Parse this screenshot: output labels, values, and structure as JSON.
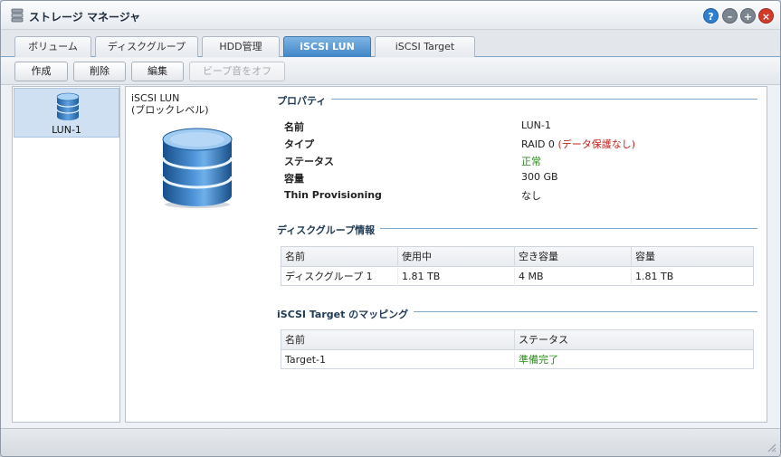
{
  "window": {
    "title": "ストレージ マネージャ"
  },
  "colors": {
    "accent": "#3f85c7",
    "ok": "#2e8b1f",
    "warn": "#c0231b"
  },
  "tabs": [
    {
      "label": "ボリューム"
    },
    {
      "label": "ディスクグループ"
    },
    {
      "label": "HDD管理"
    },
    {
      "label": "iSCSI LUN",
      "active": true
    },
    {
      "label": "iSCSI Target"
    }
  ],
  "toolbar": {
    "create": "作成",
    "delete": "削除",
    "edit": "編集",
    "beep_off": "ビープ音をオフ"
  },
  "lun_list": [
    {
      "name": "LUN-1"
    }
  ],
  "detail": {
    "type_line1": "iSCSI LUN",
    "type_line2": "(ブロックレベル)",
    "properties": {
      "title": "プロパティ",
      "rows": [
        {
          "label": "名前",
          "value": "LUN-1"
        },
        {
          "label": "タイプ",
          "value": "RAID 0",
          "note": "(データ保護なし)"
        },
        {
          "label": "ステータス",
          "value": "正常"
        },
        {
          "label": "容量",
          "value": "300 GB"
        },
        {
          "label": "Thin Provisioning",
          "value": "なし"
        }
      ]
    },
    "disk_group": {
      "title": "ディスクグループ情報",
      "headers": [
        "名前",
        "使用中",
        "空き容量",
        "容量"
      ],
      "rows": [
        [
          "ディスクグループ 1",
          "1.81 TB",
          "4 MB",
          "1.81 TB"
        ]
      ]
    },
    "mapping": {
      "title": "iSCSI Target のマッピング",
      "headers": [
        "名前",
        "ステータス"
      ],
      "rows": [
        [
          "Target-1",
          "準備完了"
        ]
      ]
    }
  }
}
